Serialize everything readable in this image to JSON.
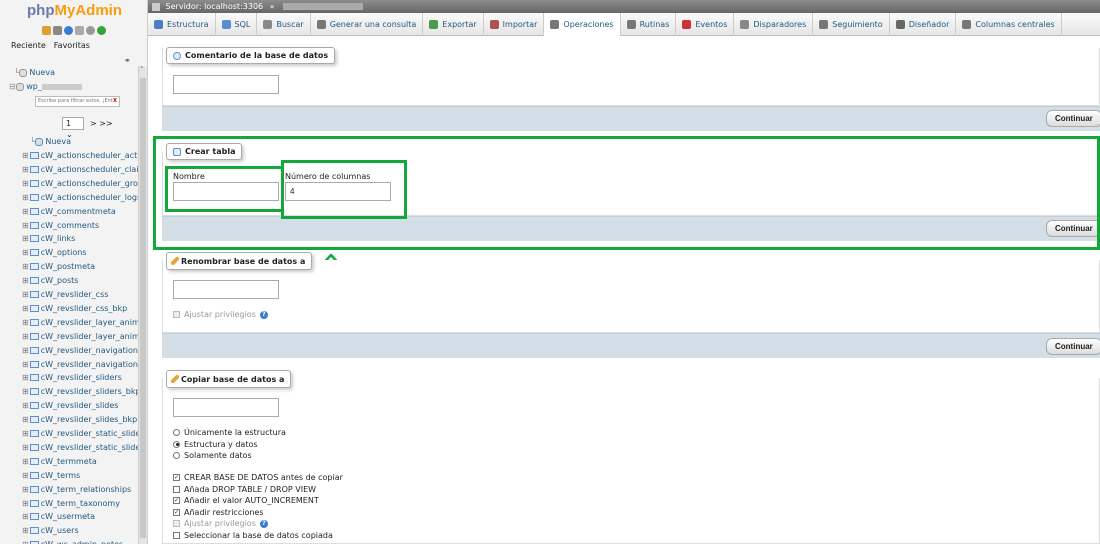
{
  "app": {
    "logo_php": "php",
    "logo_admin": "MyAdmin"
  },
  "topbar": {
    "server_label": "Servidor: localhost:3306",
    "separator": "»"
  },
  "sidebar": {
    "tabs": [
      "Reciente",
      "Favoritas"
    ],
    "collapse_icon": "link-icon",
    "new_label": "Nueva",
    "db_name": "wp_",
    "filter_placeholder": "Escribe para filtrar estos, ¡Ent",
    "filter_clear": "X",
    "pager_value": "1",
    "pager_next": "> >>",
    "table_new": "Nueva",
    "tables": [
      "cW_actionscheduler_action",
      "cW_actionscheduler_claim",
      "cW_actionscheduler_group",
      "cW_actionscheduler_logs",
      "cW_commentmeta",
      "cW_comments",
      "cW_links",
      "cW_options",
      "cW_postmeta",
      "cW_posts",
      "cW_revslider_css",
      "cW_revslider_css_bkp",
      "cW_revslider_layer_animat",
      "cW_revslider_layer_animat",
      "cW_revslider_navigations",
      "cW_revslider_navigations_",
      "cW_revslider_sliders",
      "cW_revslider_sliders_bkp",
      "cW_revslider_slides",
      "cW_revslider_slides_bkp",
      "cW_revslider_static_slides",
      "cW_revslider_static_slides_",
      "cW_termmeta",
      "cW_terms",
      "cW_term_relationships",
      "cW_term_taxonomy",
      "cW_usermeta",
      "cW_users",
      "cW_wc_admin_notes"
    ]
  },
  "tabs": [
    {
      "label": "Estructura",
      "icon": "structure-icon",
      "color": "#4a7fc1"
    },
    {
      "label": "SQL",
      "icon": "sql-icon",
      "color": "#5b8dd4"
    },
    {
      "label": "Buscar",
      "icon": "search-icon",
      "color": "#888888"
    },
    {
      "label": "Generar una consulta",
      "icon": "query-icon",
      "color": "#777777"
    },
    {
      "label": "Exportar",
      "icon": "export-icon",
      "color": "#4c9a4c"
    },
    {
      "label": "Importar",
      "icon": "import-icon",
      "color": "#b05050"
    },
    {
      "label": "Operaciones",
      "icon": "wrench-icon",
      "color": "#777777"
    },
    {
      "label": "Rutinas",
      "icon": "routines-icon",
      "color": "#777777"
    },
    {
      "label": "Eventos",
      "icon": "clock-icon",
      "color": "#cc3333"
    },
    {
      "label": "Disparadores",
      "icon": "triggers-icon",
      "color": "#888888"
    },
    {
      "label": "Seguimiento",
      "icon": "eye-icon",
      "color": "#777777"
    },
    {
      "label": "Diseñador",
      "icon": "designer-icon",
      "color": "#666666"
    },
    {
      "label": "Columnas centrales",
      "icon": "columns-icon",
      "color": "#777777"
    }
  ],
  "active_tab": "Operaciones",
  "comment_section": {
    "legend": "Comentario de la base de datos",
    "value": "",
    "button": "Continuar"
  },
  "create_table": {
    "legend": "Crear tabla",
    "name_label": "Nombre",
    "name_value": "",
    "columns_label": "Número de columnas",
    "columns_value": "4",
    "button": "Continuar"
  },
  "rename_section": {
    "legend": "Renombrar base de datos a",
    "value": "",
    "adjust_privileges": "Ajustar privilegios",
    "button": "Continuar"
  },
  "copy_section": {
    "legend": "Copiar base de datos a",
    "value": "",
    "radio_options": [
      {
        "label": "Únicamente la estructura",
        "checked": false
      },
      {
        "label": "Estructura y datos",
        "checked": true
      },
      {
        "label": "Solamente datos",
        "checked": false
      }
    ],
    "check_options": [
      {
        "label": "CREAR BASE DE DATOS antes de copiar",
        "checked": true,
        "disabled": false
      },
      {
        "label": "Añada DROP TABLE / DROP VIEW",
        "checked": false,
        "disabled": false
      },
      {
        "label": "Añadir el valor AUTO_INCREMENT",
        "checked": true,
        "disabled": false
      },
      {
        "label": "Añadir restricciones",
        "checked": true,
        "disabled": false
      },
      {
        "label": "Ajustar privilegios",
        "checked": false,
        "disabled": true
      },
      {
        "label": "Seleccionar la base de datos copiada",
        "checked": false,
        "disabled": false
      }
    ]
  },
  "colors": {
    "highlight": "#14a83b",
    "link": "#235a81",
    "footer_bg": "#d4dee6"
  }
}
